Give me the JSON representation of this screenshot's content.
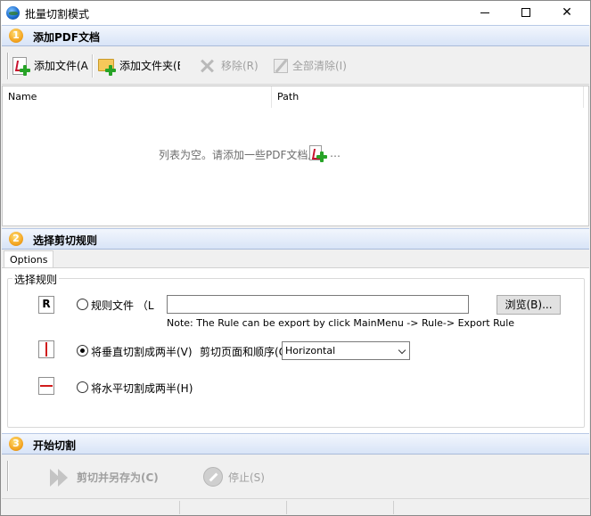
{
  "window": {
    "title": "批量切割模式",
    "minimize_glyph": "",
    "maximize_glyph": "",
    "close_glyph": "✕"
  },
  "step1": {
    "number": "1",
    "title": "添加PDF文档",
    "toolbar": {
      "add_file": "添加文件(A",
      "add_folder": "添加文件夹(E",
      "remove": "移除(R)",
      "clear_all": "全部清除(I)"
    },
    "list": {
      "columns": [
        "Name",
        "Path"
      ],
      "empty_message": "列表为空。请添加一些PDF文档用",
      "empty_suffix": "…"
    }
  },
  "step2": {
    "number": "2",
    "title": "选择剪切规则",
    "tab": "Options",
    "group_title": "选择规则",
    "rule_file": {
      "icon_letter": "R",
      "label": "规则文件 （L",
      "value": "",
      "browse_label": "浏览(B)...",
      "note": "Note: The Rule can be export by click MainMenu -> Rule-> Export Rule"
    },
    "vertical": {
      "label": "将垂直切割成两半(V)",
      "order_label": "剪切页面和顺序(O",
      "order_value": "Horizontal"
    },
    "horizontal": {
      "label": "将水平切割成两半(H)"
    },
    "selected": "vertical"
  },
  "step3": {
    "number": "3",
    "title": "开始切割",
    "cut_save": "剪切并另存为(C)",
    "stop": "停止(S)"
  }
}
